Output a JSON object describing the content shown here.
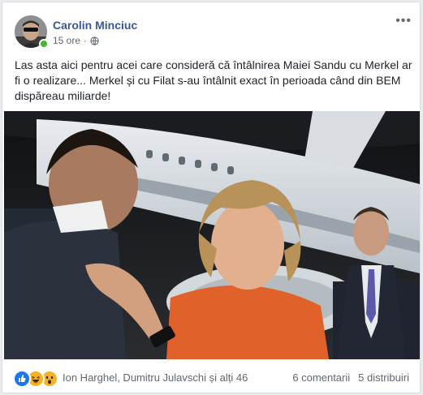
{
  "post": {
    "author": "Carolin Minciuc",
    "time": "15 ore",
    "separator": "·",
    "more_label": "•••",
    "text": "Las asta aici pentru acei care consideră că întâlnirea Maiei Sandu cu Merkel ar fi o realizare... Merkel și cu Filat s-au întâlnit exact în perioada când din BEM dispăreau miliarde!",
    "photo_alt": "photo",
    "reactions": {
      "icons": [
        "like-icon",
        "haha-icon",
        "wow-icon"
      ],
      "names": "Ion Harghel, Dumitru Julavschi și alți 46",
      "comments": "6 comentarii",
      "shares": "5 distribuiri"
    }
  },
  "colors": {
    "link": "#385898",
    "secondary_text": "#616770",
    "online": "#42b72a",
    "like_blue": "#1877f2",
    "emoji_yellow": "#f7b125"
  }
}
